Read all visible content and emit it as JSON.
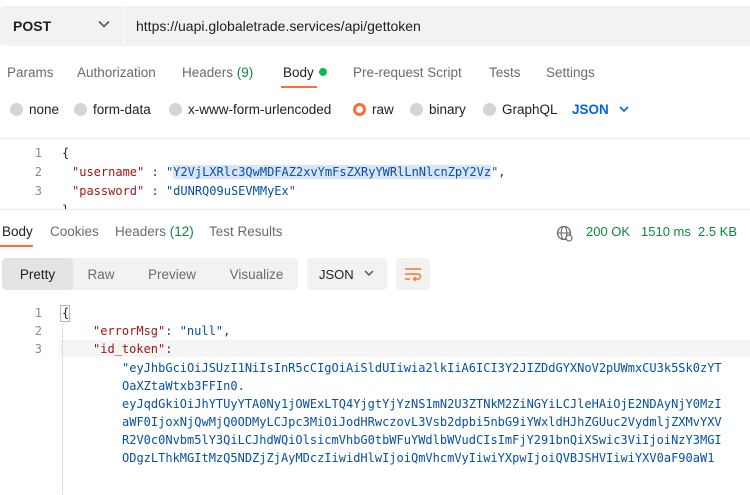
{
  "request": {
    "method": "POST",
    "url": "https://uapi.globaletrade.services/api/gettoken"
  },
  "request_tabs": [
    {
      "label": "Params"
    },
    {
      "label": "Authorization"
    },
    {
      "label": "Headers",
      "count": "(9)"
    },
    {
      "label": "Body"
    },
    {
      "label": "Pre-request Script"
    },
    {
      "label": "Tests"
    },
    {
      "label": "Settings"
    }
  ],
  "body_types": [
    "none",
    "form-data",
    "x-www-form-urlencoded",
    "raw",
    "binary",
    "GraphQL"
  ],
  "body_type_selected": "raw",
  "body_format": "JSON",
  "request_body": {
    "line_numbers": [
      "1",
      "2",
      "3"
    ],
    "brace_open": "{",
    "username_key": "\"username\"",
    "username_value": "Y2VjLXRlc3QwMDFAZ2xvYmFsZXRyYWRlLnNlcnZpY2Vz",
    "password_key": "\"password\"",
    "password_value": "\"dUNRQ09uSEVMMyEx\""
  },
  "response_tabs": [
    {
      "label": "Body"
    },
    {
      "label": "Cookies"
    },
    {
      "label": "Headers",
      "count": "(12)"
    },
    {
      "label": "Test Results"
    }
  ],
  "response_status": {
    "code": "200 OK",
    "time": "1510 ms",
    "size": "2.5 KB"
  },
  "view_modes": [
    "Pretty",
    "Raw",
    "Preview",
    "Visualize"
  ],
  "view_mode_selected": "Pretty",
  "response_format": "JSON",
  "response_body": {
    "line_numbers": [
      "1",
      "2",
      "3"
    ],
    "brace_open": "{",
    "errorMsg_key": "\"errorMsg\"",
    "errorMsg_value": "\"null\"",
    "id_token_key": "\"id_token\"",
    "token_lines": [
      "\"eyJhbGciOiJSUzI1NiIsInR5cCIgOiAiSldUIiwia2lkIiA6ICI3Y2JIZDdGYXNoV2pUWmxCU3k5Sk0zYT",
      "OaXZtaWtxb3FFIn0.",
      "eyJqdGkiOiJhYTUyYTA0Ny1jOWExLTQ4YjgtYjYzNS1mN2U3ZTNkM2ZiNGYiLCJleHAiOjE2NDAyNjY0MzI",
      "aWF0IjoxNjQwMjQ0ODMyLCJpc3MiOiJodHRwczovL3Vsb2dpbi5nbG9iYWxldHJhZGUuc2VydmljZXMvYXV",
      "R2V0c0Nvbm5lY3QiLCJhdWQiOlsicmVhbG0tbWFuYWdlbWVudCIsImFjY291bnQiXSwic3ViIjoiNzY3MGI",
      "ODgzLThkMGItMzQ5NDZjZjAyMDczIiwidHlwIjoiQmVhcmVyIiwiYXpwIjoiQVBJSHVIiwiYXV0aF90aW1"
    ]
  },
  "colors": {
    "accent": "#ff6c37",
    "status_green": "#0a8a3a",
    "link_blue": "#0265d2"
  }
}
